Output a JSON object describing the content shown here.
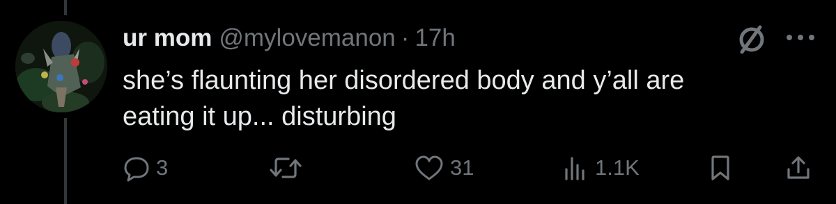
{
  "tweet": {
    "author": {
      "display_name": "ur mom",
      "handle": "@mylovemanon"
    },
    "separator": "·",
    "timestamp": "17h",
    "text_line1": "she’s flaunting her disordered body and y’all are",
    "text_line2": "eating it up... disturbing"
  },
  "actions": {
    "reply_count": "3",
    "retweet_count": "",
    "like_count": "31",
    "views_count": "1.1K"
  },
  "icons": {
    "avatar": "avatar-image",
    "grok": "grok-icon",
    "more": "more-icon",
    "reply": "reply-icon",
    "retweet": "retweet-icon",
    "like": "heart-icon",
    "views": "views-icon",
    "bookmark": "bookmark-icon",
    "share": "share-icon"
  },
  "colors": {
    "background": "#000000",
    "text_primary": "#e7e9ea",
    "text_secondary": "#71767b",
    "thread_line": "#333639"
  }
}
